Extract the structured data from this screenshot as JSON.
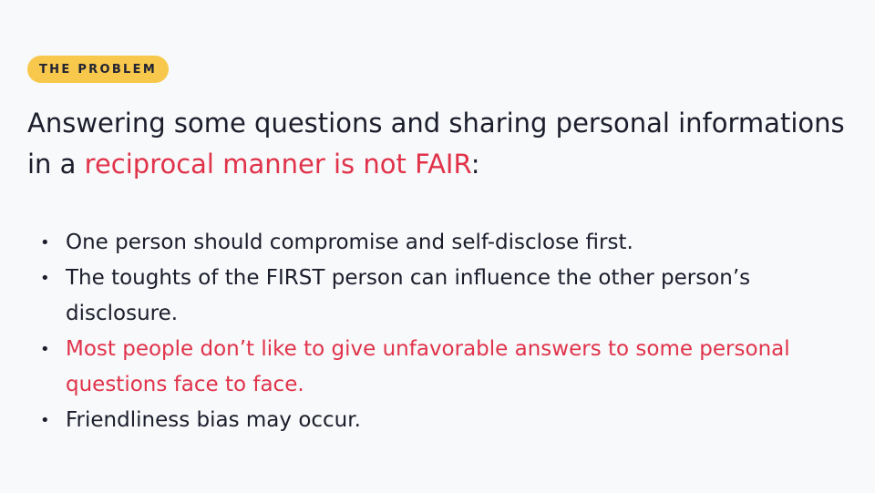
{
  "badge": {
    "label": "THE PROBLEM"
  },
  "heading": {
    "part1": "Answering some questions and sharing personal informations in a ",
    "highlight": "reciprocal manner is not FAIR",
    "part2": ":"
  },
  "bullets": [
    {
      "text": "One person should compromise and self-disclose first."
    },
    {
      "text": "The toughts of the FIRST person can influence the other person’s disclosure."
    },
    {
      "text": "Most people don’t like to give unfavorable answers to some personal questions face to face."
    },
    {
      "text": "Friendliness bias may occur."
    }
  ],
  "colors": {
    "background": "#f8f9fb",
    "badge": "#f7c84c",
    "accent": "#e0334a",
    "text": "#1b1d2b"
  }
}
